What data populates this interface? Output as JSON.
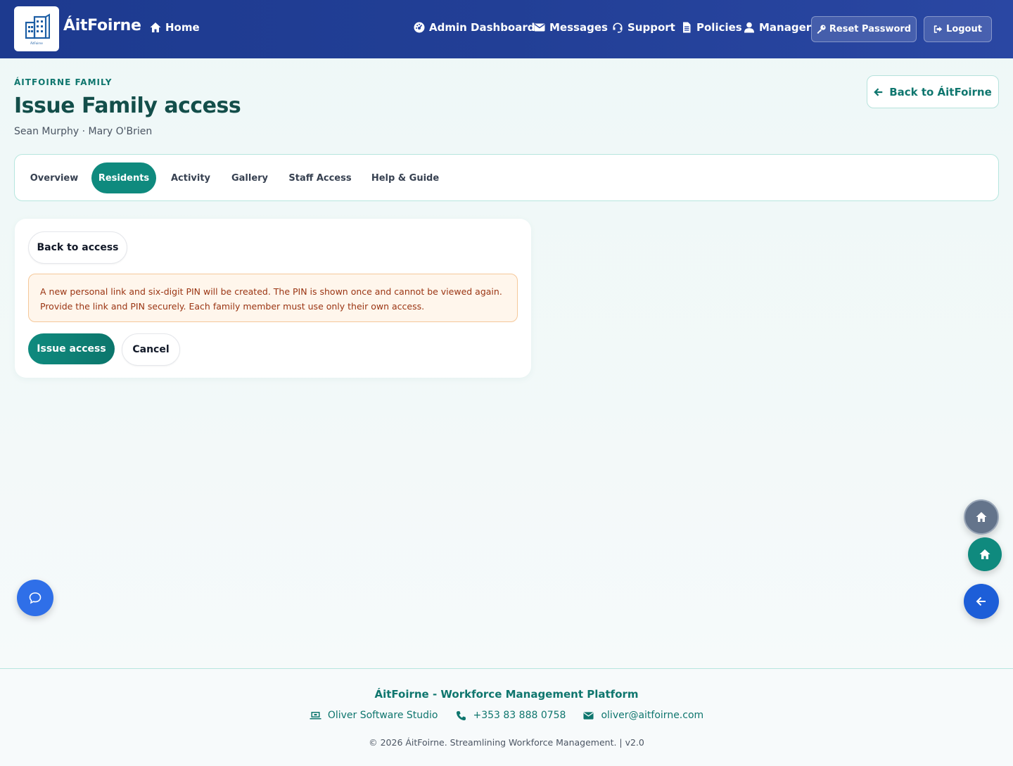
{
  "header": {
    "brand": "ÁitFoirne",
    "logo_small_text": "ÁitFoirne",
    "home": "Home",
    "admin_dashboard": "Admin Dashboard",
    "messages": "Messages",
    "support": "Support",
    "policies": "Policies",
    "manager": "Manager",
    "reset_password": "Reset Password",
    "logout": "Logout"
  },
  "page": {
    "eyebrow": "ÁITFOIRNE FAMILY",
    "title": "Issue Family access",
    "subtitle": "Sean Murphy · Mary O'Brien",
    "back_main": "Back to ÁitFoirne"
  },
  "tabs": [
    {
      "label": "Overview",
      "active": false
    },
    {
      "label": "Residents",
      "active": true
    },
    {
      "label": "Activity",
      "active": false
    },
    {
      "label": "Gallery",
      "active": false
    },
    {
      "label": "Staff Access",
      "active": false
    },
    {
      "label": "Help & Guide",
      "active": false
    }
  ],
  "card": {
    "back_label": "Back to access",
    "notice": "A new personal link and six-digit PIN will be created. The PIN is shown once and cannot be viewed again. Provide the link and PIN securely. Each family member must use only their own access.",
    "issue_label": "Issue access",
    "cancel_label": "Cancel"
  },
  "footer": {
    "title": "ÁitFoirne - Workforce Management Platform",
    "studio": "Oliver Software Studio",
    "phone": "+353 83 888 0758",
    "email": "oliver@aitfoirne.com",
    "copyright": "© 2026 ÁitFoirne. Streamlining Workforce Management. | v2.0"
  },
  "colors": {
    "nav": "#1d3a8f",
    "accent": "#0f8a7e",
    "notice_bg": "#fff6ec",
    "notice_text": "#9a3412",
    "fab_blue": "#2563eb",
    "fab_gray": "#64748b"
  },
  "icons": [
    "building-logo-icon",
    "home-icon",
    "dashboard-icon",
    "envelope-icon",
    "headset-icon",
    "document-icon",
    "user-icon",
    "key-icon",
    "logout-icon",
    "arrow-left-icon",
    "chat-icon",
    "laptop-icon",
    "phone-icon"
  ]
}
